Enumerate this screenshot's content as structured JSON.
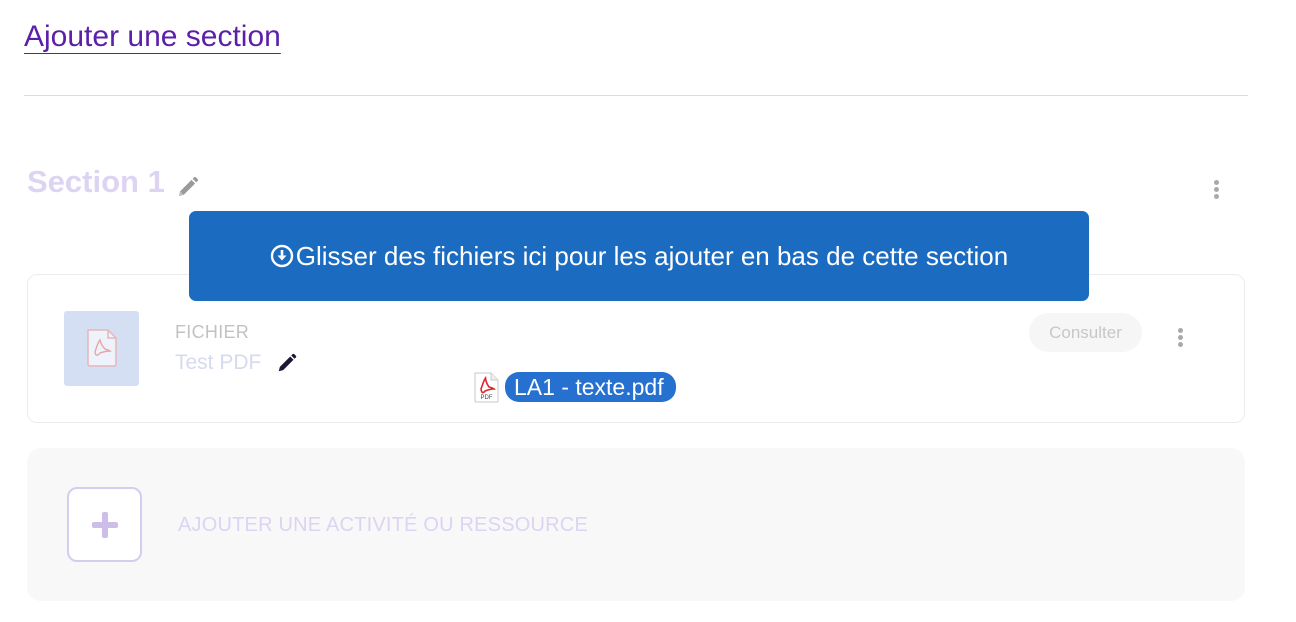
{
  "header": {
    "add_section_label": "Ajouter une section"
  },
  "section": {
    "title": "Section 1",
    "resources": [
      {
        "type_label": "FICHIER",
        "name": "Test PDF",
        "consult_label": "Consulter",
        "icon": "pdf-file-icon"
      }
    ],
    "add_activity_label": "AJOUTER UNE ACTIVITÉ OU RESSOURCE"
  },
  "drop_zone": {
    "message": "Glisser des fichiers ici pour les ajouter en bas de cette section",
    "icon": "download-circle-icon"
  },
  "drag": {
    "file_name": "LA1 - texte.pdf",
    "file_icon_text": "PDF"
  },
  "colors": {
    "link": "#5b1fa8",
    "drop_banner": "#1b6cc0",
    "drag_label": "#2670d0",
    "section_title": "#ddd3f2"
  }
}
